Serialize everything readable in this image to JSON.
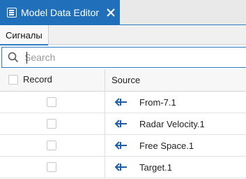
{
  "tab": {
    "title": "Model Data Editor"
  },
  "subtab": {
    "label": "Сигналы"
  },
  "search": {
    "placeholder": "Search",
    "value": ""
  },
  "table": {
    "columns": {
      "record": "Record",
      "source": "Source"
    },
    "rows": [
      {
        "source": "From-7.1"
      },
      {
        "source": "Radar Velocity.1"
      },
      {
        "source": "Free Space.1"
      },
      {
        "source": "Target.1"
      }
    ]
  },
  "colors": {
    "accent": "#1f6fba",
    "signal_icon": "#1f5fa8"
  },
  "icons": {
    "app": "model-data-editor-icon",
    "close": "close-icon",
    "search": "search-icon",
    "signal": "signal-line-icon"
  }
}
